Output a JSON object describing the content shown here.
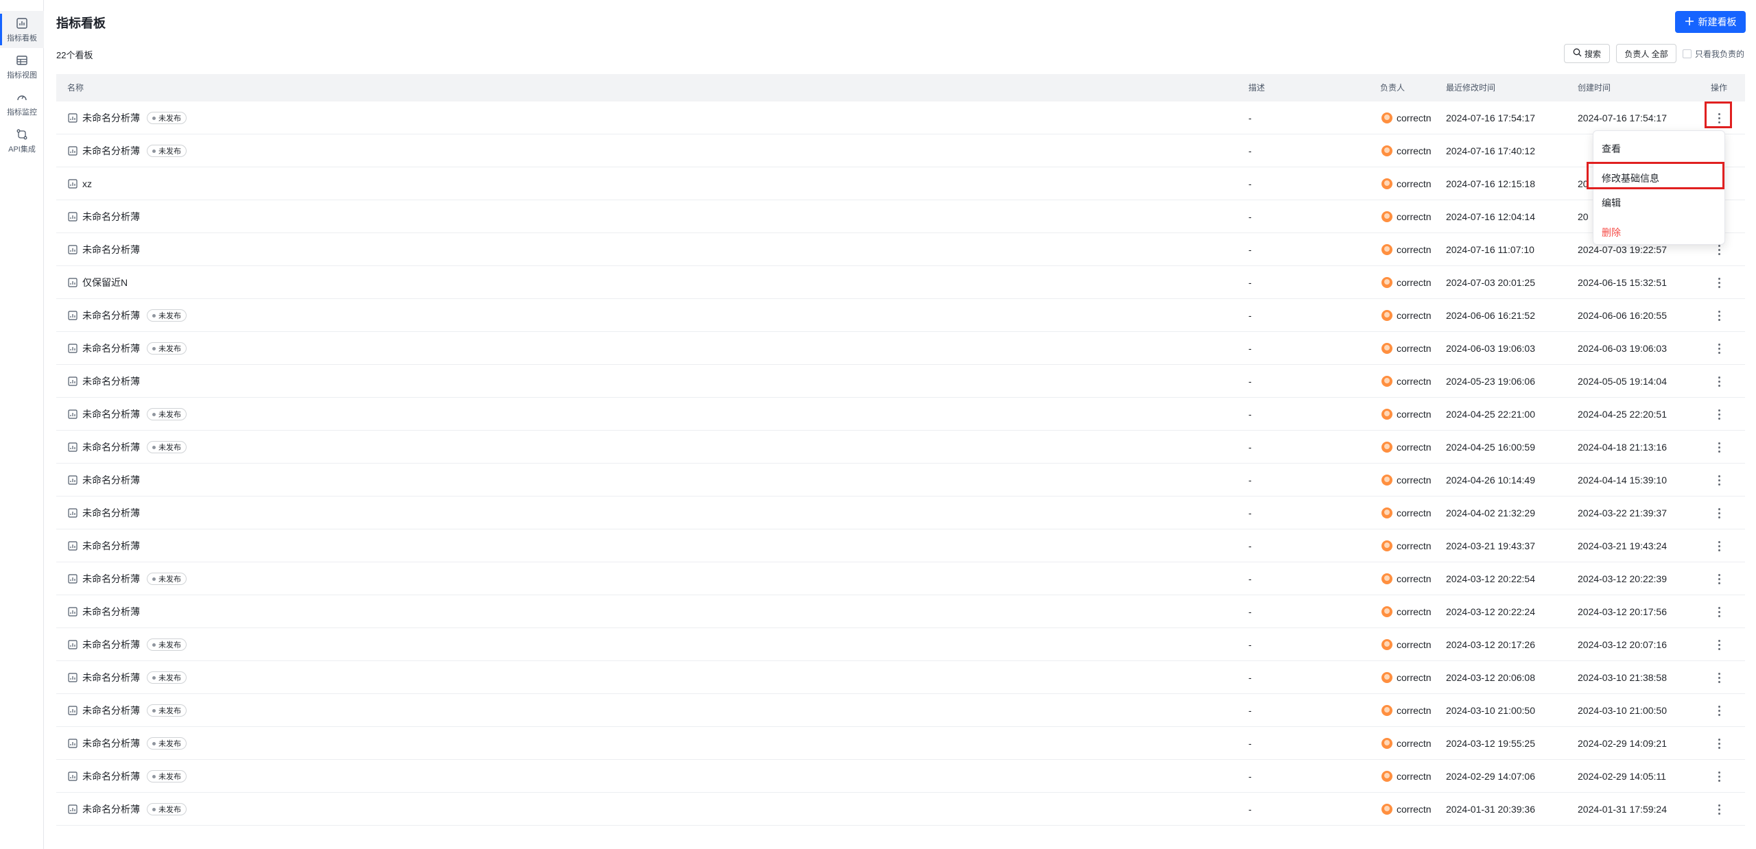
{
  "sidebar": {
    "items": [
      {
        "label": "指标看板",
        "icon": "dashboard-icon",
        "active": true
      },
      {
        "label": "指标视图",
        "icon": "table-view-icon",
        "active": false
      },
      {
        "label": "指标监控",
        "icon": "gauge-icon",
        "active": false
      },
      {
        "label": "API集成",
        "icon": "api-icon",
        "active": false
      }
    ]
  },
  "header": {
    "title": "指标看板",
    "new_button": "新建看板",
    "count": "22个看板",
    "search_label": "搜索",
    "owner_filter": "负责人 全部",
    "only_mine": "只看我负责的"
  },
  "table": {
    "columns": {
      "name": "名称",
      "desc": "描述",
      "owner": "负责人",
      "modified": "最近修改时间",
      "created": "创建时间",
      "actions": "操作"
    },
    "rows": [
      {
        "name": "未命名分析薄",
        "badge": "未发布",
        "desc": "-",
        "owner": "correctn",
        "modified": "2024-07-16 17:54:17",
        "created": "2024-07-16 17:54:17"
      },
      {
        "name": "未命名分析薄",
        "badge": "未发布",
        "desc": "-",
        "owner": "correctn",
        "modified": "2024-07-16 17:40:12",
        "created": ""
      },
      {
        "name": "xz",
        "badge": "",
        "desc": "-",
        "owner": "correctn",
        "modified": "2024-07-16 12:15:18",
        "created": "20"
      },
      {
        "name": "未命名分析薄",
        "badge": "",
        "desc": "-",
        "owner": "correctn",
        "modified": "2024-07-16 12:04:14",
        "created": "20"
      },
      {
        "name": "未命名分析薄",
        "badge": "",
        "desc": "-",
        "owner": "correctn",
        "modified": "2024-07-16 11:07:10",
        "created": "2024-07-03 19:22:57"
      },
      {
        "name": "仅保留近N",
        "badge": "",
        "desc": "-",
        "owner": "correctn",
        "modified": "2024-07-03 20:01:25",
        "created": "2024-06-15 15:32:51"
      },
      {
        "name": "未命名分析薄",
        "badge": "未发布",
        "desc": "-",
        "owner": "correctn",
        "modified": "2024-06-06 16:21:52",
        "created": "2024-06-06 16:20:55"
      },
      {
        "name": "未命名分析薄",
        "badge": "未发布",
        "desc": "-",
        "owner": "correctn",
        "modified": "2024-06-03 19:06:03",
        "created": "2024-06-03 19:06:03"
      },
      {
        "name": "未命名分析薄",
        "badge": "",
        "desc": "-",
        "owner": "correctn",
        "modified": "2024-05-23 19:06:06",
        "created": "2024-05-05 19:14:04"
      },
      {
        "name": "未命名分析薄",
        "badge": "未发布",
        "desc": "-",
        "owner": "correctn",
        "modified": "2024-04-25 22:21:00",
        "created": "2024-04-25 22:20:51"
      },
      {
        "name": "未命名分析薄",
        "badge": "未发布",
        "desc": "-",
        "owner": "correctn",
        "modified": "2024-04-25 16:00:59",
        "created": "2024-04-18 21:13:16"
      },
      {
        "name": "未命名分析薄",
        "badge": "",
        "desc": "-",
        "owner": "correctn",
        "modified": "2024-04-26 10:14:49",
        "created": "2024-04-14 15:39:10"
      },
      {
        "name": "未命名分析薄",
        "badge": "",
        "desc": "-",
        "owner": "correctn",
        "modified": "2024-04-02 21:32:29",
        "created": "2024-03-22 21:39:37"
      },
      {
        "name": "未命名分析薄",
        "badge": "",
        "desc": "-",
        "owner": "correctn",
        "modified": "2024-03-21 19:43:37",
        "created": "2024-03-21 19:43:24"
      },
      {
        "name": "未命名分析薄",
        "badge": "未发布",
        "desc": "-",
        "owner": "correctn",
        "modified": "2024-03-12 20:22:54",
        "created": "2024-03-12 20:22:39"
      },
      {
        "name": "未命名分析薄",
        "badge": "",
        "desc": "-",
        "owner": "correctn",
        "modified": "2024-03-12 20:22:24",
        "created": "2024-03-12 20:17:56"
      },
      {
        "name": "未命名分析薄",
        "badge": "未发布",
        "desc": "-",
        "owner": "correctn",
        "modified": "2024-03-12 20:17:26",
        "created": "2024-03-12 20:07:16"
      },
      {
        "name": "未命名分析薄",
        "badge": "未发布",
        "desc": "-",
        "owner": "correctn",
        "modified": "2024-03-12 20:06:08",
        "created": "2024-03-10 21:38:58"
      },
      {
        "name": "未命名分析薄",
        "badge": "未发布",
        "desc": "-",
        "owner": "correctn",
        "modified": "2024-03-10 21:00:50",
        "created": "2024-03-10 21:00:50"
      },
      {
        "name": "未命名分析薄",
        "badge": "未发布",
        "desc": "-",
        "owner": "correctn",
        "modified": "2024-03-12 19:55:25",
        "created": "2024-02-29 14:09:21"
      },
      {
        "name": "未命名分析薄",
        "badge": "未发布",
        "desc": "-",
        "owner": "correctn",
        "modified": "2024-02-29 14:07:06",
        "created": "2024-02-29 14:05:11"
      },
      {
        "name": "未命名分析薄",
        "badge": "未发布",
        "desc": "-",
        "owner": "correctn",
        "modified": "2024-01-31 20:39:36",
        "created": "2024-01-31 17:59:24"
      }
    ]
  },
  "menu": {
    "items": [
      {
        "label": "查看",
        "danger": false
      },
      {
        "label": "修改基础信息",
        "danger": false
      },
      {
        "label": "编辑",
        "danger": false
      },
      {
        "label": "删除",
        "danger": true
      }
    ]
  },
  "colors": {
    "primary": "#1664ff",
    "highlight": "#e02020",
    "danger": "#f54a45"
  }
}
